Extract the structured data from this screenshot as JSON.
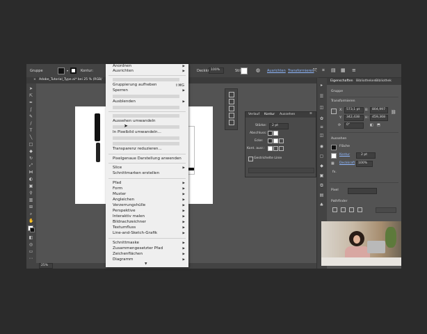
{
  "control_bar": {
    "selection_label": "Gruppe",
    "stroke_label": "Kontur:",
    "opacity_label": "Deckkraft:",
    "opacity_value": "100%",
    "style_label": "Stil:",
    "align_label": "Ausrichten",
    "transform_label": "Transformieren"
  },
  "document_tab": {
    "title": "Adobe_Tutorial_Type.ai* bei 25 % (RGB/"
  },
  "status_bar": {
    "zoom": "25%"
  },
  "context_menu": {
    "items": [
      {
        "label": "Anordnen",
        "arrow": true
      },
      {
        "label": "Ausrichten",
        "arrow": true
      },
      {
        "label": "Gruppierung aufheben",
        "shortcut": "⇧⌘G"
      },
      {
        "label": "Sperren",
        "arrow": true
      },
      {
        "label": "Ausblenden",
        "arrow": true
      },
      {
        "label": "Aussehen umwandeln"
      },
      {
        "label": "In Pixelbild umwandeln..."
      },
      {
        "label": "Transparenz reduzieren..."
      },
      {
        "label": "Pixelgenaue Darstellung anwenden"
      },
      {
        "label": "Slice",
        "arrow": true
      },
      {
        "label": "Schnittmarken erstellen"
      },
      {
        "label": "Pfad",
        "arrow": true
      },
      {
        "label": "Form",
        "arrow": true
      },
      {
        "label": "Muster",
        "arrow": true
      },
      {
        "label": "Angleichen",
        "arrow": true
      },
      {
        "label": "Verzerrungshülle",
        "arrow": true
      },
      {
        "label": "Perspektive",
        "arrow": true
      },
      {
        "label": "Interaktiv malen",
        "arrow": true
      },
      {
        "label": "Bildnachzeichner",
        "arrow": true
      },
      {
        "label": "Textumfluss",
        "arrow": true
      },
      {
        "label": "Line-and-Sketch-Grafik",
        "arrow": true
      },
      {
        "label": "Schnittmaske",
        "arrow": true
      },
      {
        "label": "Zusammengesetzter Pfad",
        "arrow": true
      },
      {
        "label": "Zeichenflächen",
        "arrow": true
      },
      {
        "label": "Diagramm",
        "arrow": true
      }
    ],
    "scroll_down_glyph": "▼"
  },
  "stroke_panel": {
    "tabs": [
      "Verlauf",
      "Kontur",
      "Aussehen"
    ],
    "weight_label": "Stärke:",
    "weight_value": "2 pt",
    "cap_label": "Abschluss:",
    "corner_label": "Ecke:",
    "align_label": "Kont. ausr.:",
    "dashed_label": "Gestrichelte Linie"
  },
  "properties_panel": {
    "tabs": [
      "Eigenschaften",
      "Bibliotheken",
      "Bibliothek"
    ],
    "object_type": "Gruppe",
    "transform_heading": "Transformieren",
    "x_label": "X:",
    "x_value": "573,1 pt",
    "y_label": "Y:",
    "y_value": "342,438",
    "w_label": "B:",
    "w_value": "804,997",
    "h_label": "H:",
    "h_value": "459,368",
    "angle_value": "0°",
    "appearance_heading": "Aussehen",
    "fill_label": "Fläche",
    "stroke_label": "Kontur",
    "stroke_value": "2 pt",
    "opacity_label": "Deckkraft",
    "opacity_value": "100%",
    "fx_label": "fx.",
    "pixel_label": "Pixel",
    "pathfinder_heading": "Pathfinder"
  },
  "colors": {
    "workspace": "#535353",
    "panel": "#434343",
    "menu_bg": "#efefef",
    "accent": "#4f8be0"
  }
}
